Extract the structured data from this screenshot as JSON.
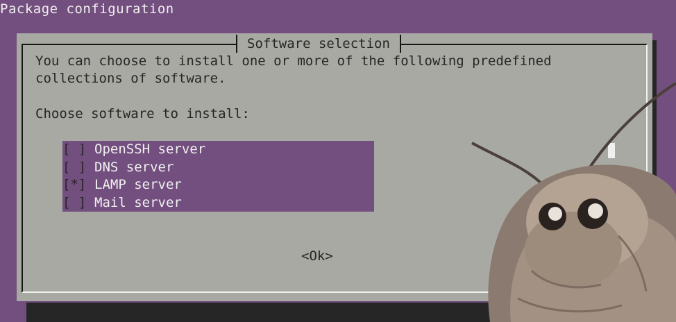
{
  "window": {
    "title": "Package configuration"
  },
  "dialog": {
    "title": "Software selection",
    "description": "You can choose to install one or more of the following predefined\ncollections of software.",
    "prompt": "Choose software to install:",
    "items": [
      {
        "checkbox": "[ ]",
        "label": "OpenSSH server",
        "checked": false
      },
      {
        "checkbox": "[ ]",
        "label": "DNS server",
        "checked": false
      },
      {
        "checkbox": "[*]",
        "label": "LAMP server",
        "checked": true
      },
      {
        "checkbox": "[ ]",
        "label": "Mail server",
        "checked": false
      }
    ],
    "ok_label": "<Ok>"
  },
  "colors": {
    "background": "#734f7f",
    "dialog": "#a9a9a3",
    "text": "#262626",
    "highlight_text": "#f0f0f0"
  }
}
